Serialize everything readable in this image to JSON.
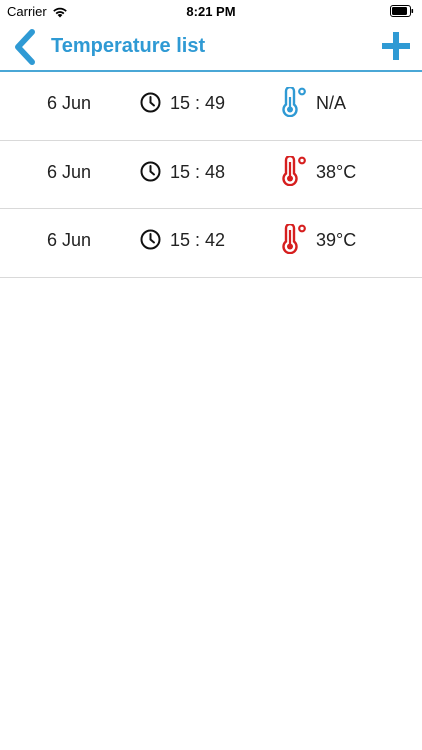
{
  "status_bar": {
    "carrier": "Carrier",
    "time": "8:21 PM"
  },
  "nav": {
    "title": "Temperature list",
    "back_icon": "chevron-left-icon",
    "add_icon": "plus-icon",
    "accent_color": "#2f9ad4"
  },
  "readings": [
    {
      "date": "6 Jun",
      "time": "15 : 49",
      "temperature": "N/A",
      "status": "unknown",
      "icon_color": "#2f9ad4"
    },
    {
      "date": "6 Jun",
      "time": "15 : 48",
      "temperature": "38°C",
      "status": "fever",
      "icon_color": "#d61f1f"
    },
    {
      "date": "6 Jun",
      "time": "15 : 42",
      "temperature": "39°C",
      "status": "fever",
      "icon_color": "#d61f1f"
    }
  ]
}
